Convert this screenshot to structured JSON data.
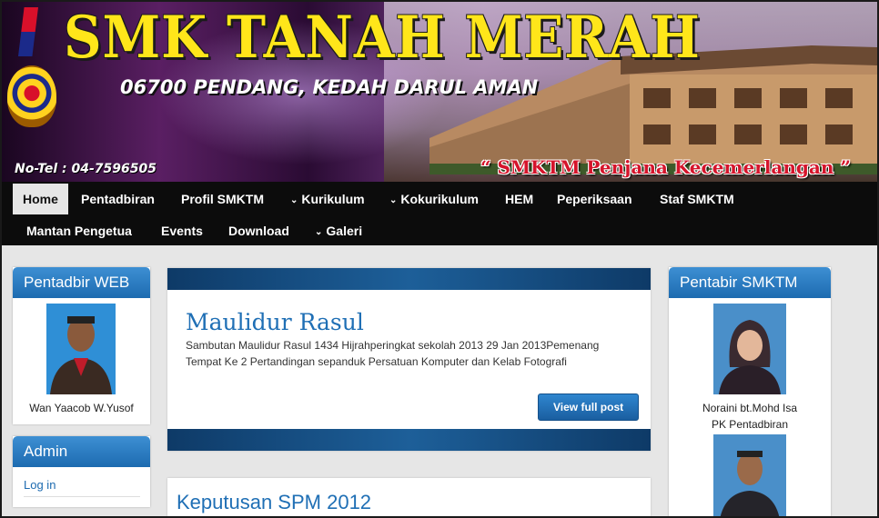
{
  "header": {
    "title": "SMK TANAH MERAH",
    "address": "06700 PENDANG, KEDAH DARUL AMAN",
    "phone": "No-Tel :  04-7596505",
    "tagline": "“ SMKTM Penjana Kecemerlangan ”",
    "title_color": "#ffe61a",
    "tagline_color": "#d5142b"
  },
  "nav": {
    "row1": [
      {
        "label": "Home",
        "active": true,
        "dropdown": false
      },
      {
        "label": "Pentadbiran",
        "dropdown": false
      },
      {
        "label": "Profil SMKTM",
        "dropdown": false
      },
      {
        "label": "Kurikulum",
        "dropdown": true
      },
      {
        "label": "Kokurikulum",
        "dropdown": true
      },
      {
        "label": "HEM",
        "dropdown": false
      },
      {
        "label": "Peperiksaan",
        "dropdown": false
      },
      {
        "label": "Staf SMKTM",
        "dropdown": false
      }
    ],
    "row2": [
      {
        "label": "Mantan Pengetua",
        "dropdown": false
      },
      {
        "label": "Events",
        "dropdown": false
      },
      {
        "label": "Download",
        "dropdown": false
      },
      {
        "label": "Galeri",
        "dropdown": true
      }
    ],
    "chevron_icon": "chevron-down-icon"
  },
  "left_sidebar": {
    "widget1": {
      "title": "Pentadbir WEB",
      "person": "Wan Yaacob W.Yusof"
    },
    "widget2": {
      "title": "Admin",
      "link": "Log in"
    }
  },
  "right_sidebar": {
    "title": "Pentabir SMKTM",
    "person1_name": "Noraini bt.Mohd Isa",
    "person1_role": "PK Pentadbiran"
  },
  "posts": [
    {
      "title": "Maulidur Rasul",
      "excerpt": "Sambutan Maulidur Rasul 1434 Hijrahperingkat sekolah 2013 29 Jan 2013Pemenang Tempat Ke 2  Pertandingan sepanduk Persatuan Komputer dan Kelab Fotografi",
      "button": "View full post"
    },
    {
      "title": "Keputusan SPM 2012"
    }
  ],
  "colors": {
    "accent": "#1d6bb0",
    "nav_bg": "#0c0c0c"
  }
}
